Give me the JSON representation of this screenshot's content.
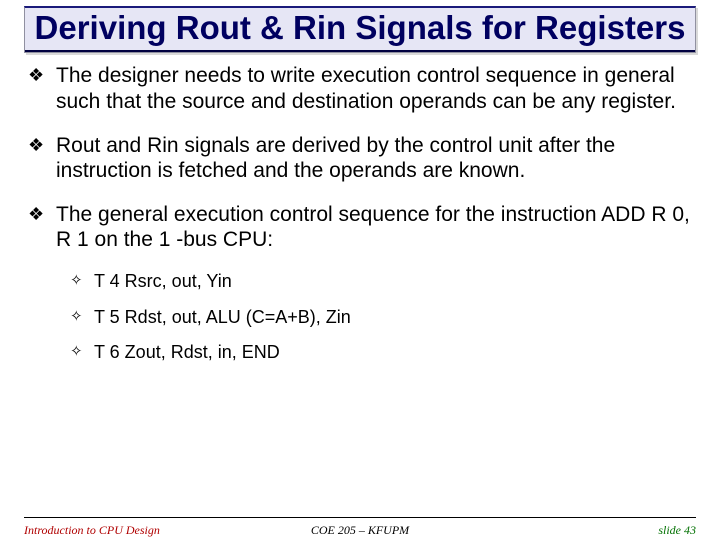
{
  "title": "Deriving Rout & Rin Signals for Registers",
  "bullets": [
    {
      "level": 1,
      "text": "The designer needs to write execution control sequence in general such that the source and destination operands can be any register."
    },
    {
      "level": 1,
      "text": "Rout and Rin signals are derived by the control unit after the instruction is fetched and the operands are known."
    },
    {
      "level": 1,
      "text": "The general execution control sequence for the instruction ADD R 0, R 1 on the 1 -bus CPU:"
    },
    {
      "level": 2,
      "text": "T 4 Rsrc, out, Yin"
    },
    {
      "level": 2,
      "text": "T 5 Rdst, out, ALU (C=A+B), Zin"
    },
    {
      "level": 2,
      "text": "T 6 Zout, Rdst, in, END"
    }
  ],
  "footer": {
    "left": "Introduction to CPU Design",
    "center": "COE 205 – KFUPM",
    "right": "slide 43"
  }
}
